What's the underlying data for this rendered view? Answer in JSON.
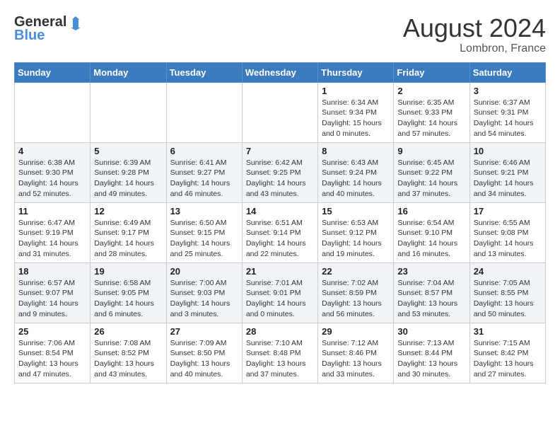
{
  "header": {
    "logo_line1": "General",
    "logo_line2": "Blue",
    "month_year": "August 2024",
    "location": "Lombron, France"
  },
  "days_of_week": [
    "Sunday",
    "Monday",
    "Tuesday",
    "Wednesday",
    "Thursday",
    "Friday",
    "Saturday"
  ],
  "weeks": [
    [
      {
        "day": "",
        "info": ""
      },
      {
        "day": "",
        "info": ""
      },
      {
        "day": "",
        "info": ""
      },
      {
        "day": "",
        "info": ""
      },
      {
        "day": "1",
        "info": "Sunrise: 6:34 AM\nSunset: 9:34 PM\nDaylight: 15 hours and 0 minutes."
      },
      {
        "day": "2",
        "info": "Sunrise: 6:35 AM\nSunset: 9:33 PM\nDaylight: 14 hours and 57 minutes."
      },
      {
        "day": "3",
        "info": "Sunrise: 6:37 AM\nSunset: 9:31 PM\nDaylight: 14 hours and 54 minutes."
      }
    ],
    [
      {
        "day": "4",
        "info": "Sunrise: 6:38 AM\nSunset: 9:30 PM\nDaylight: 14 hours and 52 minutes."
      },
      {
        "day": "5",
        "info": "Sunrise: 6:39 AM\nSunset: 9:28 PM\nDaylight: 14 hours and 49 minutes."
      },
      {
        "day": "6",
        "info": "Sunrise: 6:41 AM\nSunset: 9:27 PM\nDaylight: 14 hours and 46 minutes."
      },
      {
        "day": "7",
        "info": "Sunrise: 6:42 AM\nSunset: 9:25 PM\nDaylight: 14 hours and 43 minutes."
      },
      {
        "day": "8",
        "info": "Sunrise: 6:43 AM\nSunset: 9:24 PM\nDaylight: 14 hours and 40 minutes."
      },
      {
        "day": "9",
        "info": "Sunrise: 6:45 AM\nSunset: 9:22 PM\nDaylight: 14 hours and 37 minutes."
      },
      {
        "day": "10",
        "info": "Sunrise: 6:46 AM\nSunset: 9:21 PM\nDaylight: 14 hours and 34 minutes."
      }
    ],
    [
      {
        "day": "11",
        "info": "Sunrise: 6:47 AM\nSunset: 9:19 PM\nDaylight: 14 hours and 31 minutes."
      },
      {
        "day": "12",
        "info": "Sunrise: 6:49 AM\nSunset: 9:17 PM\nDaylight: 14 hours and 28 minutes."
      },
      {
        "day": "13",
        "info": "Sunrise: 6:50 AM\nSunset: 9:15 PM\nDaylight: 14 hours and 25 minutes."
      },
      {
        "day": "14",
        "info": "Sunrise: 6:51 AM\nSunset: 9:14 PM\nDaylight: 14 hours and 22 minutes."
      },
      {
        "day": "15",
        "info": "Sunrise: 6:53 AM\nSunset: 9:12 PM\nDaylight: 14 hours and 19 minutes."
      },
      {
        "day": "16",
        "info": "Sunrise: 6:54 AM\nSunset: 9:10 PM\nDaylight: 14 hours and 16 minutes."
      },
      {
        "day": "17",
        "info": "Sunrise: 6:55 AM\nSunset: 9:08 PM\nDaylight: 14 hours and 13 minutes."
      }
    ],
    [
      {
        "day": "18",
        "info": "Sunrise: 6:57 AM\nSunset: 9:07 PM\nDaylight: 14 hours and 9 minutes."
      },
      {
        "day": "19",
        "info": "Sunrise: 6:58 AM\nSunset: 9:05 PM\nDaylight: 14 hours and 6 minutes."
      },
      {
        "day": "20",
        "info": "Sunrise: 7:00 AM\nSunset: 9:03 PM\nDaylight: 14 hours and 3 minutes."
      },
      {
        "day": "21",
        "info": "Sunrise: 7:01 AM\nSunset: 9:01 PM\nDaylight: 14 hours and 0 minutes."
      },
      {
        "day": "22",
        "info": "Sunrise: 7:02 AM\nSunset: 8:59 PM\nDaylight: 13 hours and 56 minutes."
      },
      {
        "day": "23",
        "info": "Sunrise: 7:04 AM\nSunset: 8:57 PM\nDaylight: 13 hours and 53 minutes."
      },
      {
        "day": "24",
        "info": "Sunrise: 7:05 AM\nSunset: 8:55 PM\nDaylight: 13 hours and 50 minutes."
      }
    ],
    [
      {
        "day": "25",
        "info": "Sunrise: 7:06 AM\nSunset: 8:54 PM\nDaylight: 13 hours and 47 minutes."
      },
      {
        "day": "26",
        "info": "Sunrise: 7:08 AM\nSunset: 8:52 PM\nDaylight: 13 hours and 43 minutes."
      },
      {
        "day": "27",
        "info": "Sunrise: 7:09 AM\nSunset: 8:50 PM\nDaylight: 13 hours and 40 minutes."
      },
      {
        "day": "28",
        "info": "Sunrise: 7:10 AM\nSunset: 8:48 PM\nDaylight: 13 hours and 37 minutes."
      },
      {
        "day": "29",
        "info": "Sunrise: 7:12 AM\nSunset: 8:46 PM\nDaylight: 13 hours and 33 minutes."
      },
      {
        "day": "30",
        "info": "Sunrise: 7:13 AM\nSunset: 8:44 PM\nDaylight: 13 hours and 30 minutes."
      },
      {
        "day": "31",
        "info": "Sunrise: 7:15 AM\nSunset: 8:42 PM\nDaylight: 13 hours and 27 minutes."
      }
    ]
  ]
}
